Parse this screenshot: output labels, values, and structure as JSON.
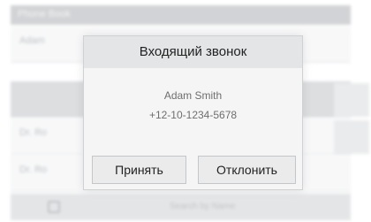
{
  "background": {
    "header_label": "Phone Book",
    "header_right": "",
    "rows": [
      "Adam",
      "",
      "Dr. Ro",
      "Dr. Ro"
    ],
    "footer_text": "Search by Name"
  },
  "dialog": {
    "title": "Входящий звонок",
    "caller_name": "Adam Smith",
    "caller_number": "+12-10-1234-5678",
    "accept_label": "Принять",
    "decline_label": "Отклонить"
  }
}
